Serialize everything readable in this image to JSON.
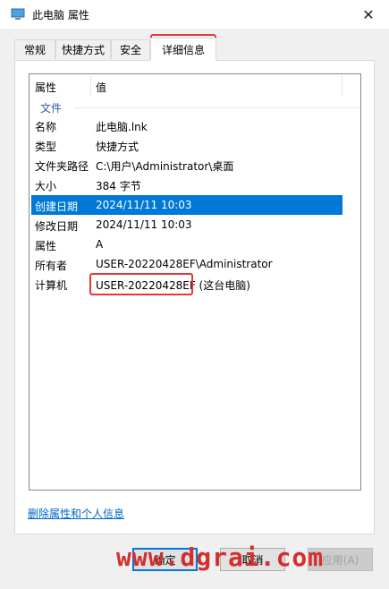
{
  "window": {
    "title": "此电脑 属性",
    "close": "✕"
  },
  "tabs": [
    "常规",
    "快捷方式",
    "安全",
    "详细信息"
  ],
  "list": {
    "headers": {
      "property": "属性",
      "value": "值"
    },
    "group": "文件",
    "rows": [
      {
        "property": "名称",
        "value": "此电脑.lnk"
      },
      {
        "property": "类型",
        "value": "快捷方式"
      },
      {
        "property": "文件夹路径",
        "value": "C:\\用户\\Administrator\\桌面"
      },
      {
        "property": "大小",
        "value": "384 字节"
      },
      {
        "property": "创建日期",
        "value": "2024/11/11 10:03"
      },
      {
        "property": "修改日期",
        "value": "2024/11/11 10:03"
      },
      {
        "property": "属性",
        "value": "A"
      },
      {
        "property": "所有者",
        "value": "USER-20220428EF\\Administrator"
      },
      {
        "property": "计算机",
        "value": "USER-20220428EF (这台电脑)"
      }
    ]
  },
  "links": {
    "remove_properties": "删除属性和个人信息"
  },
  "buttons": {
    "ok": "确定",
    "cancel": "取消",
    "apply": "应用(A)"
  },
  "watermark": "www.dgrai.com",
  "colors": {
    "selection": "#0078d7",
    "annotation": "#e53935"
  }
}
